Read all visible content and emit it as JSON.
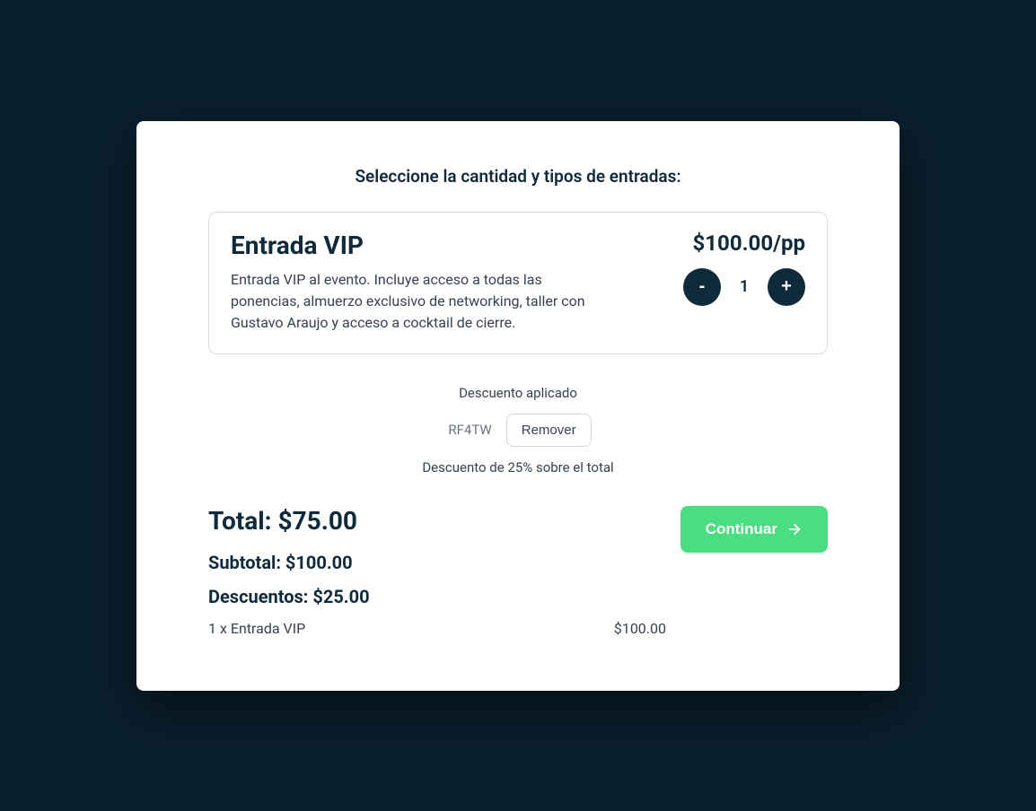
{
  "header": {
    "title": "Seleccione la cantidad y tipos de entradas:"
  },
  "ticket": {
    "title": "Entrada VIP",
    "description": "Entrada VIP al evento. Incluye acceso a todas las ponencias, almuerzo exclusivo de networking, taller con Gustavo Araujo y acceso a cocktail de cierre.",
    "price": "$100.00/pp",
    "quantity": "1",
    "minus_label": "-",
    "plus_label": "+"
  },
  "discount": {
    "applied_label": "Descuento aplicado",
    "code": "RF4TW",
    "remove_label": "Remover",
    "detail": "Descuento de 25% sobre el total"
  },
  "totals": {
    "total": "Total: $75.00",
    "subtotal": "Subtotal: $100.00",
    "discounts": "Descuentos: $25.00",
    "line_item_label": "1 x Entrada VIP",
    "line_item_price": "$100.00"
  },
  "actions": {
    "continue_label": "Continuar"
  }
}
